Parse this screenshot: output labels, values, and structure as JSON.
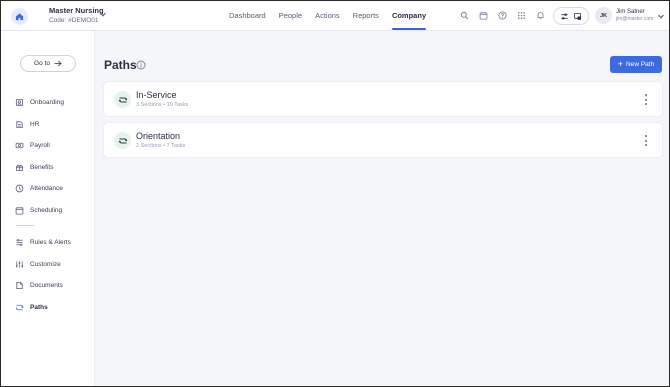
{
  "header": {
    "org_name": "Master Nursing",
    "org_code": "Code: #DEMO01",
    "nav": [
      {
        "label": "Dashboard",
        "active": false
      },
      {
        "label": "People",
        "active": false
      },
      {
        "label": "Actions",
        "active": false
      },
      {
        "label": "Reports",
        "active": false
      },
      {
        "label": "Company",
        "active": true
      }
    ],
    "tool_icons": [
      "search-icon",
      "calendar-icon",
      "help-icon",
      "apps-grid-icon",
      "bell-icon"
    ],
    "user": {
      "initials": "JK",
      "name": "Jim Satner",
      "email": "jim@master.com"
    },
    "accent_color": "#3a62d8"
  },
  "sidebar": {
    "goto_label": "Go to",
    "items": [
      {
        "label": "Onboarding",
        "icon": "onboarding-icon"
      },
      {
        "label": "HR",
        "icon": "hr-icon"
      },
      {
        "label": "Payroll",
        "icon": "payroll-icon"
      },
      {
        "label": "Benefits",
        "icon": "benefits-icon"
      },
      {
        "label": "Attendance",
        "icon": "attendance-icon"
      },
      {
        "label": "Scheduling",
        "icon": "scheduling-icon"
      }
    ],
    "items2": [
      {
        "label": "Rules & Alerts",
        "icon": "rules-icon"
      },
      {
        "label": "Customize",
        "icon": "customize-icon"
      },
      {
        "label": "Documents",
        "icon": "documents-icon"
      },
      {
        "label": "Paths",
        "icon": "paths-icon",
        "active": true
      }
    ]
  },
  "main": {
    "title": "Paths",
    "new_button_label": "New Path",
    "button_color": "#3d6ae0",
    "paths": [
      {
        "title": "In-Service",
        "meta": "3 Sections • 10 Tasks"
      },
      {
        "title": "Orientation",
        "meta": "2 Sections • 7 Tasks"
      }
    ]
  }
}
